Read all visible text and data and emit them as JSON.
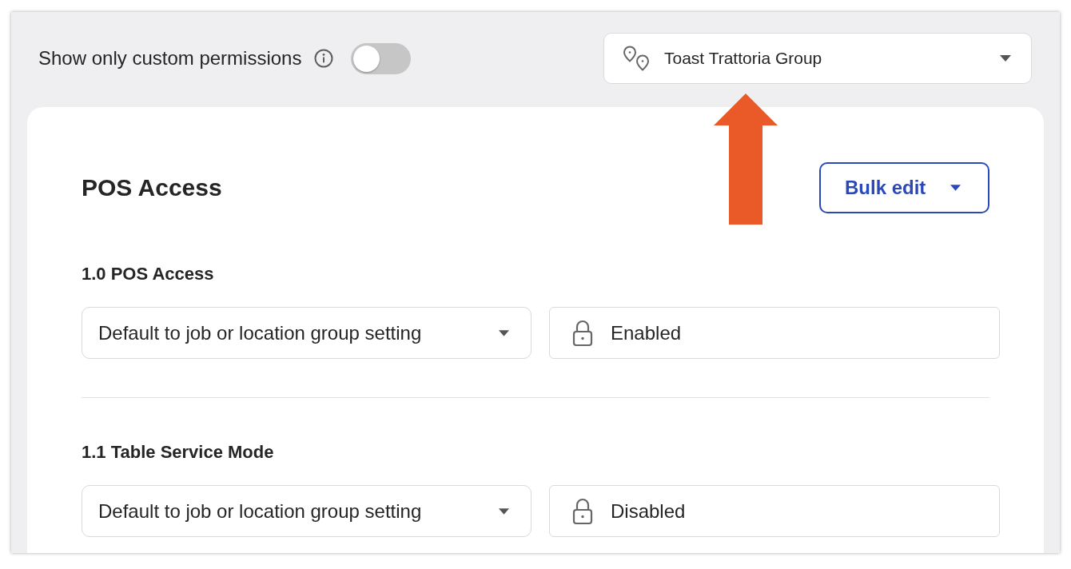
{
  "filters": {
    "custom_only_label": "Show only custom permissions",
    "custom_only": {
      "on": false
    },
    "location": "Toast Trattoria Group"
  },
  "section": {
    "title": "POS Access",
    "bulk_edit": "Bulk edit",
    "permissions": [
      {
        "name": "1.0 POS Access",
        "setting": "Default to job or location group setting",
        "status": "Enabled"
      },
      {
        "name": "1.1 Table Service Mode",
        "setting": "Default to job or location group setting",
        "status": "Disabled"
      }
    ]
  }
}
